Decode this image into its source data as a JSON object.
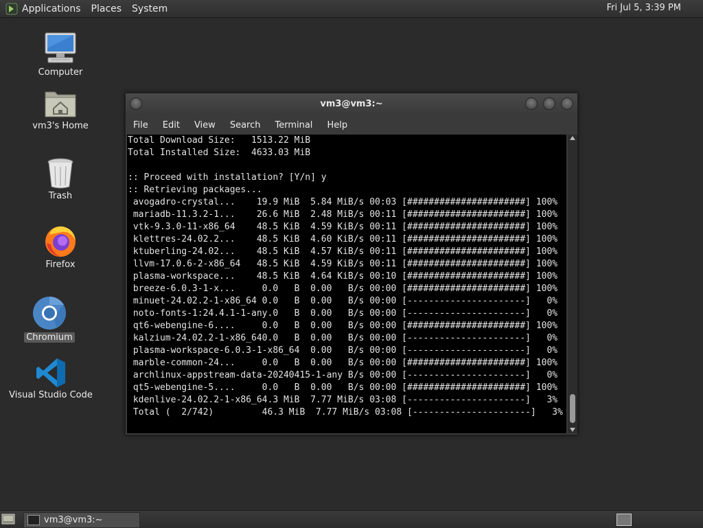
{
  "top_panel": {
    "menus": [
      "Applications",
      "Places",
      "System"
    ],
    "clock": "Fri Jul  5,  3:39 PM"
  },
  "desktop": {
    "icons": [
      {
        "label": "Computer",
        "icon": "computer-icon"
      },
      {
        "label": "vm3's Home",
        "icon": "home-folder-icon"
      },
      {
        "label": "Trash",
        "icon": "trash-icon"
      },
      {
        "label": "Firefox",
        "icon": "firefox-icon"
      },
      {
        "label": "Chromium",
        "icon": "chromium-icon",
        "selected": true
      },
      {
        "label": "Visual Studio Code",
        "icon": "vscode-icon"
      }
    ]
  },
  "terminal": {
    "title": "vm3@vm3:~",
    "menu": [
      "File",
      "Edit",
      "View",
      "Search",
      "Terminal",
      "Help"
    ],
    "lines": [
      "Total Download Size:   1513.22 MiB",
      "Total Installed Size:  4633.03 MiB",
      "",
      ":: Proceed with installation? [Y/n] y",
      ":: Retrieving packages...",
      " avogadro-crystal...    19.9 MiB  5.84 MiB/s 00:03 [######################] 100%",
      " mariadb-11.3.2-1...    26.6 MiB  2.48 MiB/s 00:11 [######################] 100%",
      " vtk-9.3.0-11-x86_64    48.5 KiB  4.59 KiB/s 00:11 [######################] 100%",
      " klettres-24.02.2...    48.5 KiB  4.60 KiB/s 00:11 [######################] 100%",
      " ktuberling-24.02...    48.5 KiB  4.57 KiB/s 00:11 [######################] 100%",
      " llvm-17.0.6-2-x86_64   48.5 KiB  4.59 KiB/s 00:11 [######################] 100%",
      " plasma-workspace...    48.5 KiB  4.64 KiB/s 00:10 [######################] 100%",
      " breeze-6.0.3-1-x...     0.0   B  0.00   B/s 00:00 [######################] 100%",
      " minuet-24.02.2-1-x86_64 0.0   B  0.00   B/s 00:00 [----------------------]   0%",
      " noto-fonts-1:24.4.1-1-any.0   B  0.00   B/s 00:00 [----------------------]   0%",
      " qt6-webengine-6....     0.0   B  0.00   B/s 00:00 [######################] 100%",
      " kalzium-24.02.2-1-x86_640.0   B  0.00   B/s 00:00 [----------------------]   0%",
      " plasma-workspace-6.0.3-1-x86_64  0.00   B/s 00:00 [----------------------]   0%",
      " marble-common-24...     0.0   B  0.00   B/s 00:00 [######################] 100%",
      " archlinux-appstream-data-20240415-1-any B/s 00:00 [----------------------]   0%",
      " qt5-webengine-5....     0.0   B  0.00   B/s 00:00 [######################] 100%",
      " kdenlive-24.02.2-1-x86_64.3 MiB  7.77 MiB/s 03:08 [----------------------]   3%",
      " Total (  2/742)         46.3 MiB  7.77 MiB/s 03:08 [----------------------]   3%"
    ],
    "scroll_position": 0.95
  },
  "bottom_panel": {
    "task_label": "vm3@vm3:~"
  }
}
